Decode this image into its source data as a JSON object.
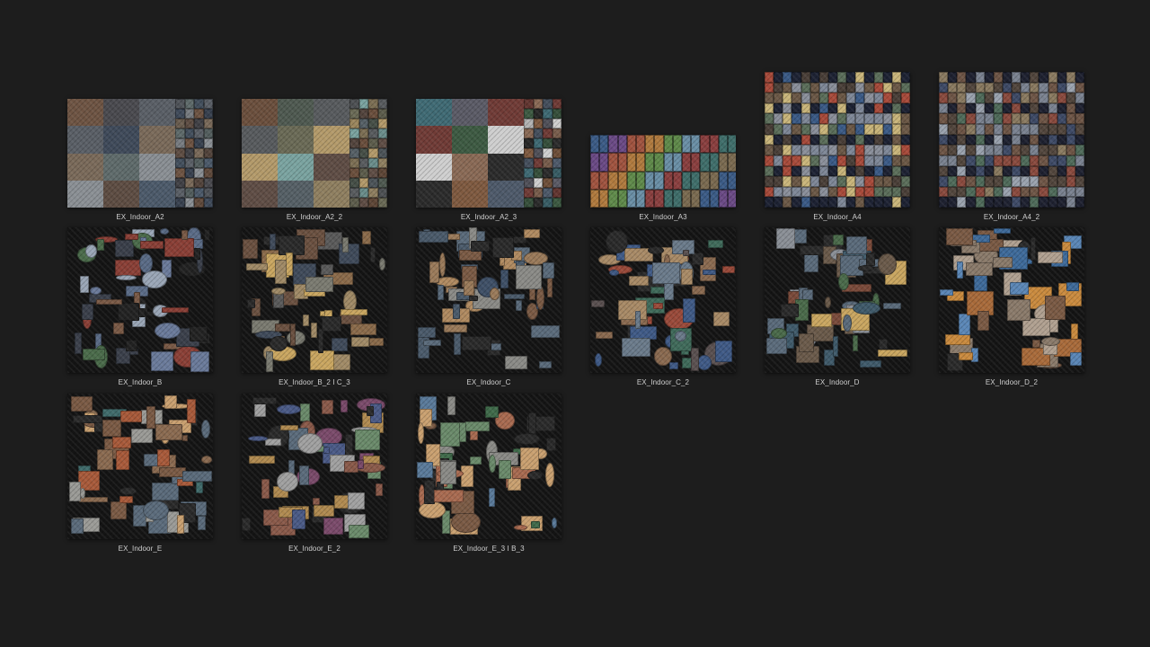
{
  "gallery": {
    "items": [
      {
        "name": "EX_Indoor_A2",
        "palette": [
          "#6e5443",
          "#4a4a4f",
          "#5a5f66",
          "#3f4a5a",
          "#7a6a5a",
          "#5f6b6b",
          "#8a8f94",
          "#5e4d43",
          "#4c5a6a"
        ]
      },
      {
        "name": "EX_Indoor_A2_2",
        "palette": [
          "#6b4f3d",
          "#4f5a51",
          "#585b5e",
          "#6a6a56",
          "#b39a6a",
          "#7aa3a0",
          "#5f4d45",
          "#566066",
          "#8f7f60"
        ]
      },
      {
        "name": "EX_Indoor_A2_3",
        "palette": [
          "#3f6a74",
          "#5b5b66",
          "#703b36",
          "#3d5a42",
          "#cfcfcf",
          "#8a6a56",
          "#2b2b2b",
          "#7f5a40",
          "#4e5a6a"
        ]
      },
      {
        "name": "EX_Indoor_A3",
        "palette": [
          "#3b5b86",
          "#6b4a86",
          "#a0533f",
          "#b07a3e",
          "#5f8a4a",
          "#6a8fa6",
          "#8a3f3f",
          "#3f6e6a",
          "#7a6a50"
        ]
      },
      {
        "name": "EX_Indoor_A4",
        "palette": [
          "#1d2233",
          "#6b5846",
          "#7e8797",
          "#5b6e5a",
          "#a84a3a",
          "#3a5a86",
          "#c9b57a",
          "#8a8f9a",
          "#4a3f38"
        ]
      },
      {
        "name": "EX_Indoor_A4_2",
        "palette": [
          "#1e2130",
          "#6e5546",
          "#7a8290",
          "#8a4a3e",
          "#4f6b5a",
          "#8a7a60",
          "#3e4a66",
          "#9aa2ae",
          "#52463d"
        ]
      },
      {
        "name": "EX_Indoor_B",
        "palette": [
          "#111111",
          "#5a6b86",
          "#8a3f36",
          "#4a6b4a",
          "#6a7a9a",
          "#9aa6b6",
          "#3a3f4a",
          "#7a5a46",
          "#222222"
        ]
      },
      {
        "name": "EX_Indoor_B_2 I C_3",
        "palette": [
          "#121212",
          "#6a5040",
          "#8a6a4a",
          "#5a5a5a",
          "#a08a66",
          "#3f4a5a",
          "#c9a660",
          "#2a2a2a",
          "#7a7a70"
        ]
      },
      {
        "name": "EX_Indoor_C",
        "palette": [
          "#121212",
          "#7a5a44",
          "#5a6a7a",
          "#9a7a5a",
          "#4a5a6a",
          "#8a8a86",
          "#3e4f66",
          "#2a2a2a",
          "#b08a60"
        ]
      },
      {
        "name": "EX_Indoor_C_2",
        "palette": [
          "#121212",
          "#8a6a50",
          "#3f5a86",
          "#9a4a3a",
          "#6a7a8a",
          "#3f6a5a",
          "#a88a66",
          "#2a2a2a",
          "#5a5050"
        ]
      },
      {
        "name": "EX_Indoor_D",
        "palette": [
          "#121212",
          "#6a5a4a",
          "#5a6a7a",
          "#8a8f96",
          "#7a4a3a",
          "#3f5a6a",
          "#c9a660",
          "#2a2a2a",
          "#4a6a4a"
        ]
      },
      {
        "name": "EX_Indoor_D_2",
        "palette": [
          "#121212",
          "#7a5a44",
          "#c98a3e",
          "#5a86b6",
          "#a86a3a",
          "#8a7a6a",
          "#3e6a9a",
          "#2a2a2a",
          "#b0a090"
        ]
      },
      {
        "name": "EX_Indoor_E",
        "palette": [
          "#121212",
          "#7a5a44",
          "#8a6a50",
          "#5a6a7a",
          "#a85a3a",
          "#9a9a96",
          "#3f6a6a",
          "#2a2a2a",
          "#c9a070"
        ]
      },
      {
        "name": "EX_Indoor_E_2",
        "palette": [
          "#121212",
          "#5a6a7a",
          "#8a5a4a",
          "#6a8a6a",
          "#b08a50",
          "#4a5a86",
          "#a0a0a0",
          "#2a2a2a",
          "#7a4a6a"
        ]
      },
      {
        "name": "EX_Indoor_E_3 I B_3",
        "palette": [
          "#121212",
          "#7a5a44",
          "#6a8a6a",
          "#5a7a9a",
          "#a86a50",
          "#3f6a4a",
          "#c9a070",
          "#2a2a2a",
          "#8a8a86"
        ]
      }
    ]
  }
}
